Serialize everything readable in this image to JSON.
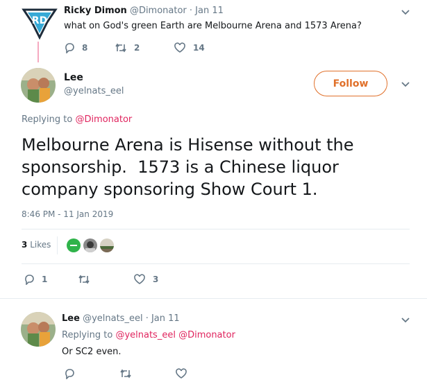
{
  "first_tweet": {
    "author_name": "Ricky Dimon",
    "author_handle": "@Dimonator",
    "date": "· Jan 11",
    "text": "what on God's green Earth are Melbourne Arena and 1573 Arena?",
    "replies": "8",
    "retweets": "2",
    "likes": "14"
  },
  "main_tweet": {
    "author_name": "Lee",
    "author_handle": "@yelnats_eel",
    "follow_label": "Follow",
    "replying_prefix": "Replying to",
    "replying_to": "@Dimonator",
    "text": "Melbourne Arena is Hisense without the sponsorship.  1573 is a Chinese liquor company sponsoring Show Court 1.",
    "timestamp": "8:46 PM - 11 Jan 2019",
    "likes_count": "3",
    "likes_label": "Likes",
    "replies": "1",
    "retweets": "",
    "likes": "3"
  },
  "reply_tweet": {
    "author_name": "Lee",
    "author_handle": "@yelnats_eel",
    "date": "· Jan 11",
    "replying_prefix": "Replying to",
    "replying_to_1": "@yelnats_eel",
    "replying_to_2": "@Dimonator",
    "text": "Or SC2 even."
  },
  "colors": {
    "accent": "#e0245e",
    "follow": "#e0702a",
    "muted": "#657786"
  },
  "icons": [
    "diamond-logo-icon",
    "reply-icon",
    "retweet-icon",
    "heart-icon",
    "chevron-down-icon"
  ]
}
